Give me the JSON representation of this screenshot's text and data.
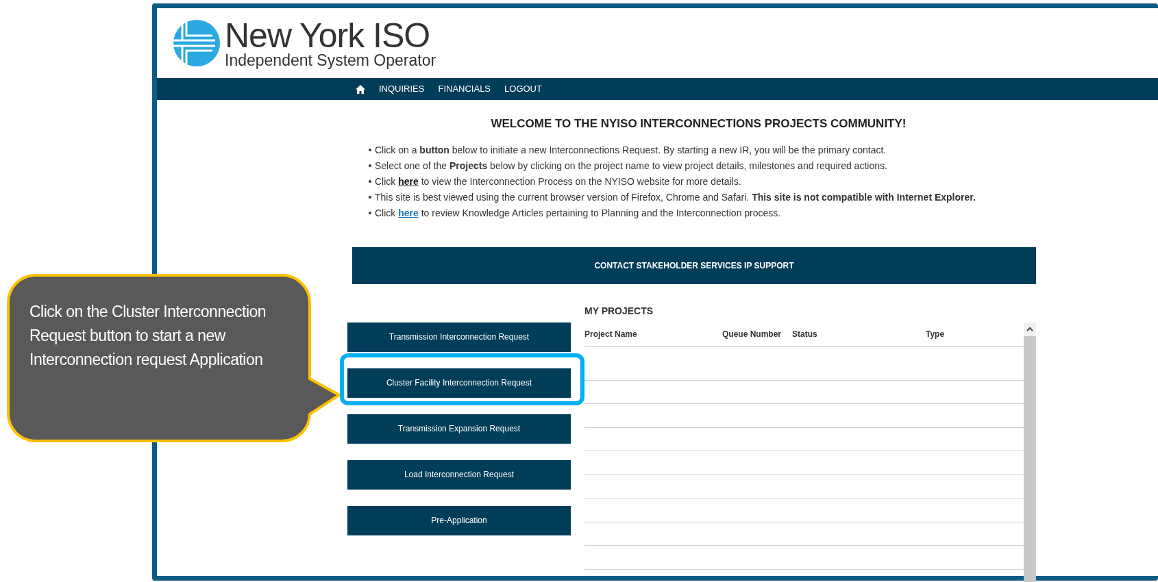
{
  "logo": {
    "title": "New York ISO",
    "subtitle": "Independent System Operator"
  },
  "nav": {
    "items": [
      {
        "kind": "home"
      },
      {
        "kind": "link",
        "label": "INQUIRIES"
      },
      {
        "kind": "link",
        "label": "FINANCIALS"
      },
      {
        "kind": "link",
        "label": "LOGOUT"
      }
    ]
  },
  "heading": "WELCOME TO THE NYISO INTERCONNECTIONS PROJECTS COMMUNITY!",
  "bullets": [
    {
      "parts": [
        {
          "kind": "text",
          "text": "Click on a **button** below to initiate a new Interconnections Request. By starting a new IR, you will be the primary contact."
        }
      ]
    },
    {
      "parts": [
        {
          "kind": "text",
          "text": "Select one of the **Projects** below by clicking on the project name to view project details, milestones and required actions."
        }
      ]
    },
    {
      "parts": [
        {
          "kind": "text",
          "text": "Click "
        },
        {
          "kind": "link",
          "text": "here",
          "color": "#111111"
        },
        {
          "kind": "text",
          "text": " to view the Interconnection Process on the NYISO website for more details."
        }
      ]
    },
    {
      "parts": [
        {
          "kind": "text",
          "text": "This site is best viewed using the current browser version of Firefox, Chrome and Safari.  **This site is not compatible with Internet Explorer.**"
        }
      ]
    },
    {
      "parts": [
        {
          "kind": "text",
          "text": "Click "
        },
        {
          "kind": "link",
          "text": "here",
          "color": "#1a7ab5"
        },
        {
          "kind": "text",
          "text": " to review Knowledge Articles pertaining to Planning and the Interconnection process."
        }
      ]
    }
  ],
  "contact_button": "CONTACT STAKEHOLDER SERVICES IP SUPPORT",
  "request_buttons": [
    {
      "label": "Transmission Interconnection Request",
      "highlighted": false
    },
    {
      "label": "Cluster Facility Interconnection Request",
      "highlighted": true
    },
    {
      "label": "Transmission Expansion Request",
      "highlighted": false
    },
    {
      "label": "Load Interconnection Request",
      "highlighted": false
    },
    {
      "label": "Pre-Application",
      "highlighted": false
    }
  ],
  "projects": {
    "title": "MY PROJECTS",
    "columns": [
      "Project Name",
      "Queue Number",
      "Status",
      "Type"
    ]
  },
  "callout": {
    "text": "Click on the Cluster Interconnection Request button to start a new Interconnection request Application"
  }
}
